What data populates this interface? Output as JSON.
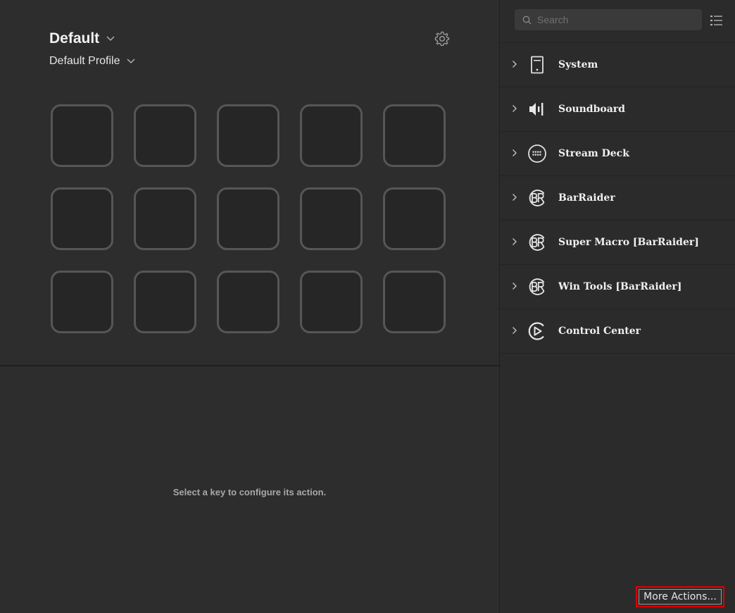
{
  "device": {
    "name": "Default"
  },
  "profile": {
    "name": "Default Profile"
  },
  "editor": {
    "hint": "Select a key to configure its action."
  },
  "keys": {
    "rows": 3,
    "columns": 5
  },
  "sidebar": {
    "search": {
      "placeholder": "Search",
      "value": ""
    },
    "categories": [
      {
        "label": "System",
        "icon": "system-icon"
      },
      {
        "label": "Soundboard",
        "icon": "soundboard-icon"
      },
      {
        "label": "Stream Deck",
        "icon": "stream-deck-icon"
      },
      {
        "label": "BarRaider",
        "icon": "barraider-icon"
      },
      {
        "label": "Super Macro [BarRaider]",
        "icon": "barraider-icon"
      },
      {
        "label": "Win Tools [BarRaider]",
        "icon": "barraider-icon"
      },
      {
        "label": "Control Center",
        "icon": "control-center-icon"
      }
    ],
    "more_actions_label": "More Actions..."
  },
  "colors": {
    "highlight_border": "#e00000",
    "background": "#2d2d2d"
  }
}
